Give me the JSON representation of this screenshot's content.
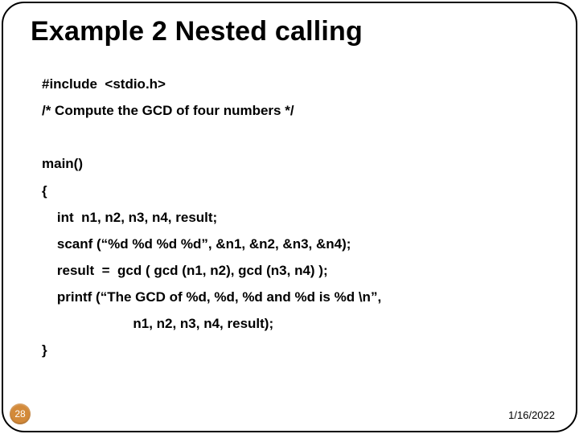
{
  "slide": {
    "title": "Example 2 Nested calling",
    "code_lines": [
      "#include  <stdio.h>",
      "/* Compute the GCD of four numbers */",
      "",
      "main()",
      "{",
      "    int  n1, n2, n3, n4, result;",
      "    scanf (“%d %d %d %d”, &n1, &n2, &n3, &n4);",
      "    result  =  gcd ( gcd (n1, n2), gcd (n3, n4) );",
      "    printf (“The GCD of %d, %d, %d and %d is %d \\n”,",
      "                        n1, n2, n3, n4, result);",
      "}"
    ],
    "slide_number": "28",
    "date": "1/16/2022"
  }
}
